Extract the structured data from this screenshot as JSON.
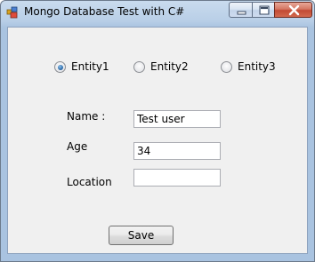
{
  "window": {
    "title": "Mongo Database Test with C#",
    "controls": {
      "minimize_icon": "minimize-icon",
      "maximize_icon": "maximize-icon",
      "close_icon": "close-icon"
    }
  },
  "entities": [
    {
      "label": "Entity1",
      "checked": true
    },
    {
      "label": "Entity2",
      "checked": false
    },
    {
      "label": "Entity3",
      "checked": false
    }
  ],
  "form": {
    "name_label": "Name :",
    "name_value": "Test user",
    "age_label": "Age",
    "age_value": "34",
    "location_label": "Location",
    "location_value": ""
  },
  "save_label": "Save"
}
